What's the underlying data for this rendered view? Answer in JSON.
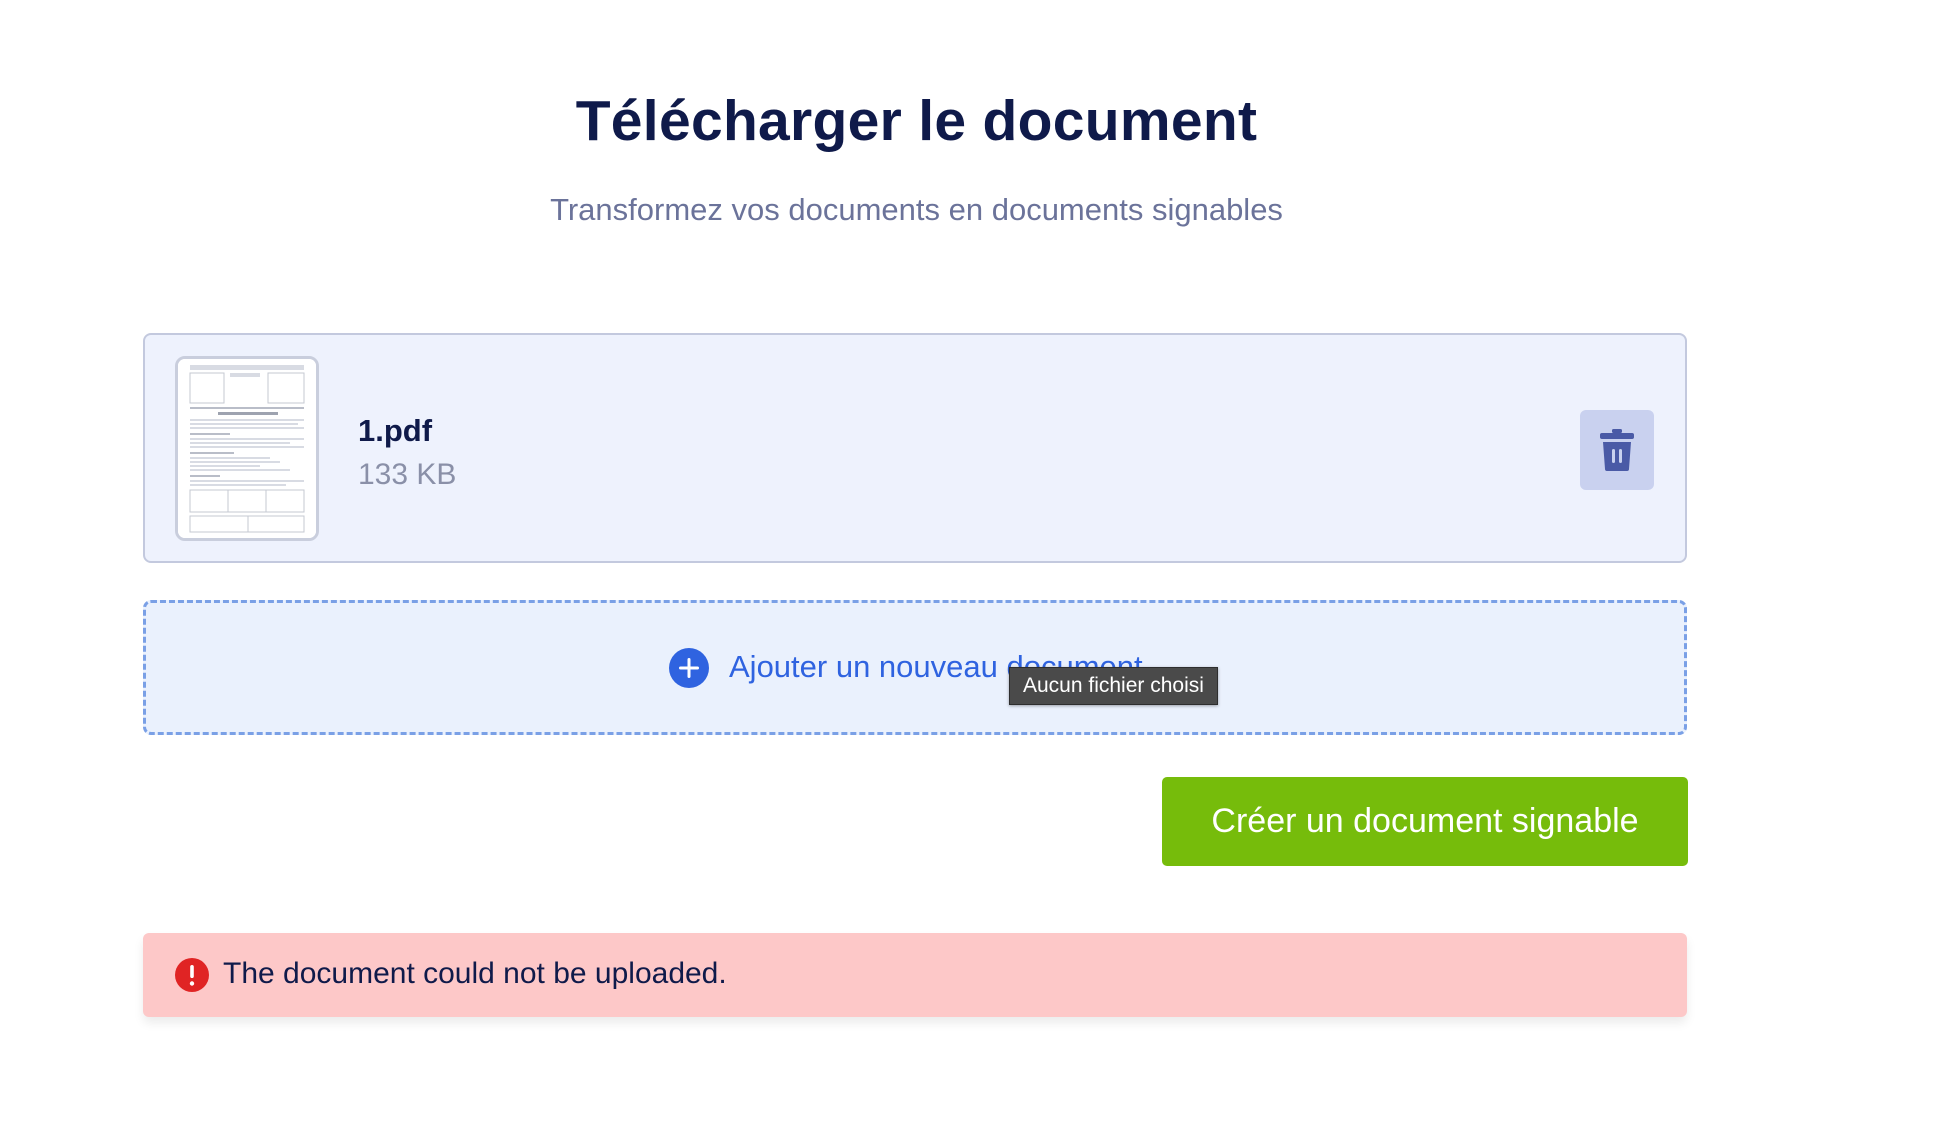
{
  "header": {
    "title": "Télécharger le document",
    "subtitle": "Transformez vos documents en documents signables"
  },
  "file": {
    "name": "1.pdf",
    "size": "133 KB",
    "thumbnail_icon": "pdf-page-thumbnail",
    "delete_icon": "trash-icon"
  },
  "dropzone": {
    "label": "Ajouter un nouveau document",
    "icon": "plus-circle-icon",
    "tooltip": "Aucun fichier choisi"
  },
  "actions": {
    "create_label": "Créer un document signable"
  },
  "error": {
    "message": "The document could not be uploaded.",
    "icon": "error-circle-icon"
  },
  "colors": {
    "title": "#0f1a4a",
    "accent_blue": "#2f63e0",
    "primary_green": "#76bc0b",
    "error_bg": "#fdc8c8",
    "error_icon": "#e02424"
  }
}
